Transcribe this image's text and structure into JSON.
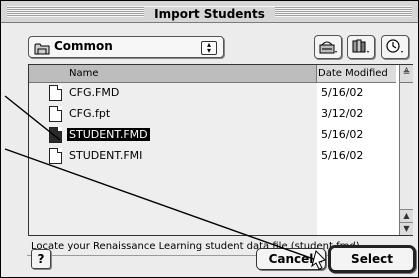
{
  "window": {
    "title": "Import Students"
  },
  "location_popup": {
    "selected": "Common"
  },
  "toolbar": {
    "icons": [
      "disk-icon",
      "shortcuts-icon",
      "recent-icon"
    ]
  },
  "file_list": {
    "columns": {
      "name": "Name",
      "date": "Date Modified"
    },
    "rows": [
      {
        "name": "CFG.FMD",
        "date": "5/16/02",
        "selected": false
      },
      {
        "name": "CFG.fpt",
        "date": "3/12/02",
        "selected": false
      },
      {
        "name": "STUDENT.FMD",
        "date": "5/16/02",
        "selected": true
      },
      {
        "name": "STUDENT.FMI",
        "date": "5/16/02",
        "selected": false
      }
    ]
  },
  "prompt": "Locate your Renaissance Learning student data file (student.fmd)",
  "buttons": {
    "help": "?",
    "cancel": "Cancel",
    "select": "Select"
  }
}
